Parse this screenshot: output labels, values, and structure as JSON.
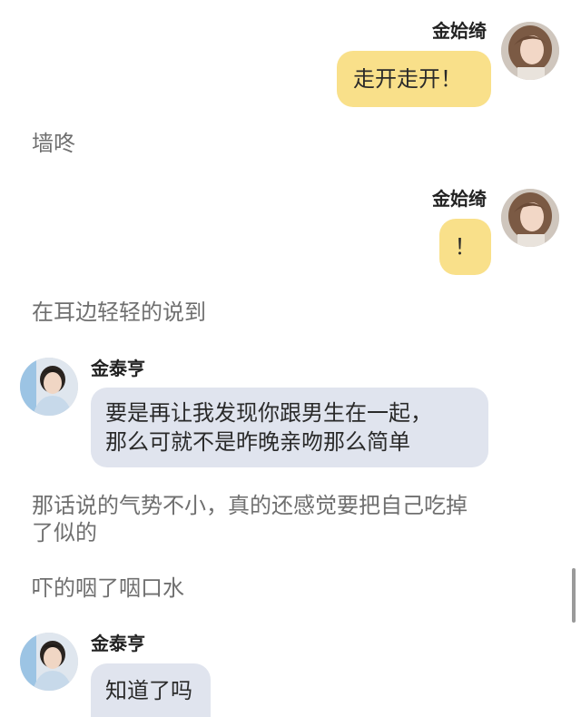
{
  "messages": [
    {
      "type": "bubble",
      "side": "right",
      "speaker": "金姶绮",
      "text": "走开走开！",
      "avatar_icon": "girl-avatar-icon"
    },
    {
      "type": "narration",
      "text": "墙咚"
    },
    {
      "type": "bubble",
      "side": "right",
      "speaker": "金姶绮",
      "text": "！",
      "avatar_icon": "girl-avatar-icon"
    },
    {
      "type": "narration",
      "text": "在耳边轻轻的说到"
    },
    {
      "type": "bubble",
      "side": "left",
      "speaker": "金泰亨",
      "lines": [
        "要是再让我发现你跟男生在一起，",
        "那么可就不是昨晚亲吻那么简单"
      ],
      "avatar_icon": "boy-avatar-icon"
    },
    {
      "type": "narration",
      "lines": [
        "那话说的气势不小，真的还感觉要把自己吃掉",
        "了似的"
      ]
    },
    {
      "type": "narration",
      "text": "吓的咽了咽口水"
    },
    {
      "type": "bubble",
      "side": "left",
      "speaker": "金泰亨",
      "text": "知道了吗",
      "avatar_icon": "boy-avatar-icon"
    }
  ],
  "colors": {
    "self_bubble": "#f9e08a",
    "other_bubble": "#e0e4ee",
    "narration_text": "#6f6f6f"
  }
}
